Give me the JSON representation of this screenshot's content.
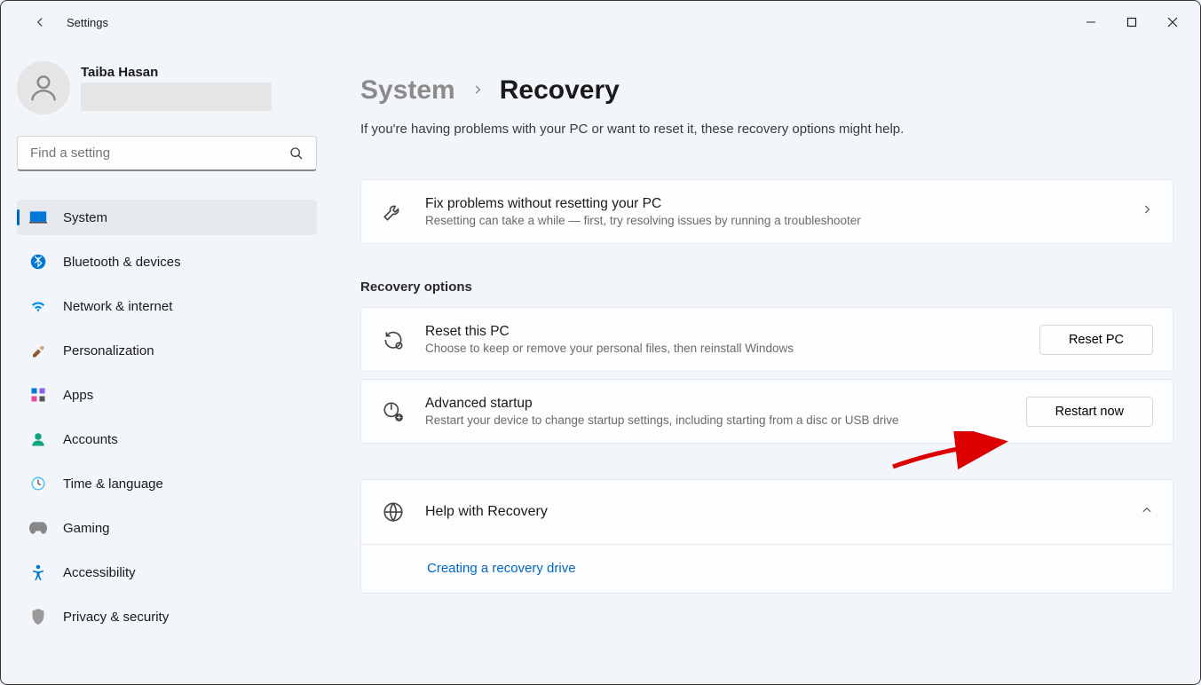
{
  "window": {
    "title": "Settings"
  },
  "user": {
    "name": "Taiba Hasan"
  },
  "search": {
    "placeholder": "Find a setting"
  },
  "sidebar": {
    "items": [
      {
        "label": "System",
        "icon": "system",
        "active": true
      },
      {
        "label": "Bluetooth & devices",
        "icon": "bluetooth",
        "active": false
      },
      {
        "label": "Network & internet",
        "icon": "wifi",
        "active": false
      },
      {
        "label": "Personalization",
        "icon": "brush",
        "active": false
      },
      {
        "label": "Apps",
        "icon": "apps",
        "active": false
      },
      {
        "label": "Accounts",
        "icon": "user",
        "active": false
      },
      {
        "label": "Time & language",
        "icon": "clock",
        "active": false
      },
      {
        "label": "Gaming",
        "icon": "gamepad",
        "active": false
      },
      {
        "label": "Accessibility",
        "icon": "accessibility",
        "active": false
      },
      {
        "label": "Privacy & security",
        "icon": "shield",
        "active": false
      }
    ]
  },
  "breadcrumb": {
    "parent": "System",
    "current": "Recovery"
  },
  "page_description": "If you're having problems with your PC or want to reset it, these recovery options might help.",
  "cards": {
    "fix": {
      "title": "Fix problems without resetting your PC",
      "subtitle": "Resetting can take a while — first, try resolving issues by running a troubleshooter"
    },
    "reset": {
      "title": "Reset this PC",
      "subtitle": "Choose to keep or remove your personal files, then reinstall Windows",
      "button": "Reset PC"
    },
    "advanced": {
      "title": "Advanced startup",
      "subtitle": "Restart your device to change startup settings, including starting from a disc or USB drive",
      "button": "Restart now"
    }
  },
  "section_header": "Recovery options",
  "help": {
    "title": "Help with Recovery",
    "link": "Creating a recovery drive"
  }
}
